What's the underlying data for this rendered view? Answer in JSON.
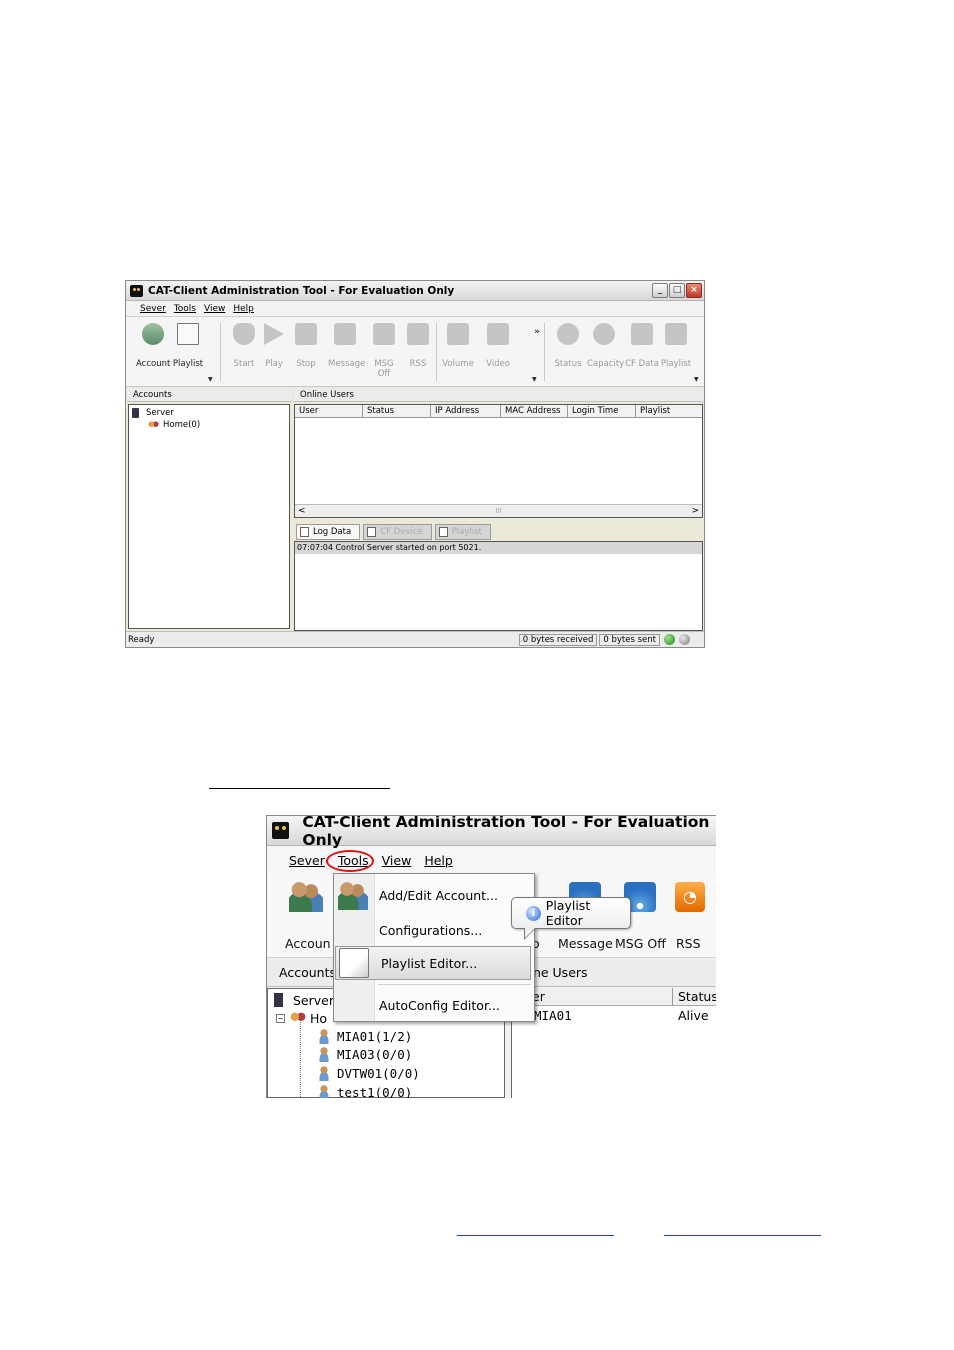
{
  "screenshot1": {
    "title": "CAT-Client Administration Tool - For Evaluation Only",
    "menu": [
      "Sever",
      "Tools",
      "View",
      "Help"
    ],
    "toolbar": [
      "Account",
      "Playlist",
      "Start",
      "Play",
      "Stop",
      "Message",
      "MSG Off",
      "RSS",
      "Volume",
      "Video",
      "Status",
      "Capacity",
      "CF Data",
      "Playlist"
    ],
    "toolbar_more": "»",
    "accounts_header": "Accounts",
    "tree": {
      "server": "Server",
      "home": "Home(0)"
    },
    "online_header": "Online Users",
    "columns": [
      "User",
      "Status",
      "IP Address",
      "MAC Address",
      "Login Time",
      "Playlist"
    ],
    "scroll_left": "<",
    "scroll_mid": "III",
    "scroll_right": ">",
    "tabs": [
      "Log Data",
      "CF Device",
      "Playlist"
    ],
    "log": "07:07:04    Control Server started on port 5021.",
    "status": {
      "ready": "Ready",
      "received": "0 bytes received",
      "sent": "0 bytes sent"
    }
  },
  "screenshot2": {
    "title": "CAT-Client Administration Tool - For Evaluation Only",
    "menu": [
      "Sever",
      "Tools",
      "View",
      "Help"
    ],
    "toolbar": {
      "account": "Accoun",
      "message": "Message",
      "msgoff": "MSG Off",
      "rss": "RSS",
      "partial": "o"
    },
    "tools_menu": [
      "Add/Edit Account...",
      "Configurations...",
      "Playlist Editor...",
      "AutoConfig Editor..."
    ],
    "tooltip": "Playlist Editor",
    "accounts_header": "Accounts",
    "online_header": "line Users",
    "tree": {
      "server": "Server",
      "home": "Ho",
      "users": [
        "MIA01(1/2)",
        "MIA03(0/0)",
        "DVTW01(0/0)",
        "test1(0/0)"
      ]
    },
    "grid": {
      "col_user": "er",
      "col_status": "Status",
      "user": "MIA01",
      "status": "Alive"
    }
  }
}
